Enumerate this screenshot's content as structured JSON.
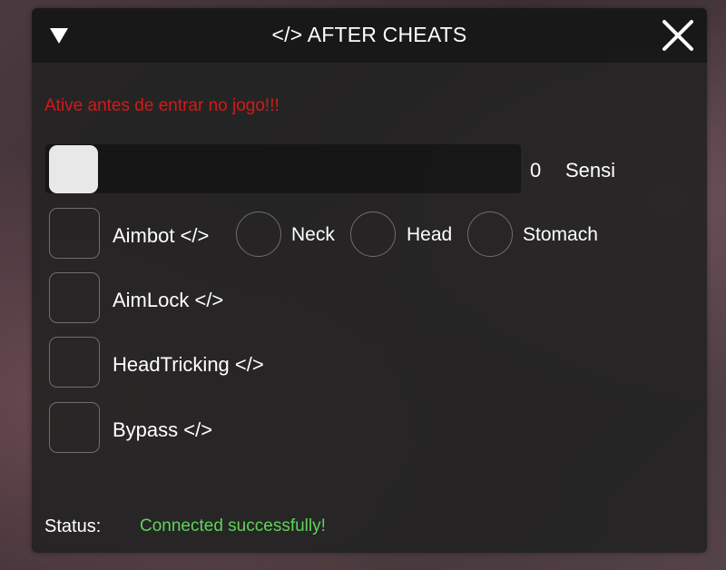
{
  "header": {
    "title": "</> AFTER CHEATS",
    "collapse_icon": "triangle-down-icon",
    "close_icon": "close-icon"
  },
  "warning": "Ative antes de entrar no jogo!!!",
  "slider": {
    "value": "0",
    "label": "Sensi",
    "level": 0
  },
  "options": [
    {
      "label": "Aimbot </>",
      "checked": false
    },
    {
      "label": "AimLock </>",
      "checked": false
    },
    {
      "label": "HeadTricking </>",
      "checked": false
    },
    {
      "label": "Bypass </>",
      "checked": false
    }
  ],
  "aim_targets": [
    {
      "label": "Neck",
      "selected": false
    },
    {
      "label": "Head",
      "selected": false
    },
    {
      "label": "Stomach",
      "selected": false
    }
  ],
  "status": {
    "label": "Status:",
    "value": "Connected successfully!"
  },
  "colors": {
    "warning": "#d21a1a",
    "status_ok": "#5fd35a",
    "panel": "#222222",
    "text": "#ffffff"
  }
}
